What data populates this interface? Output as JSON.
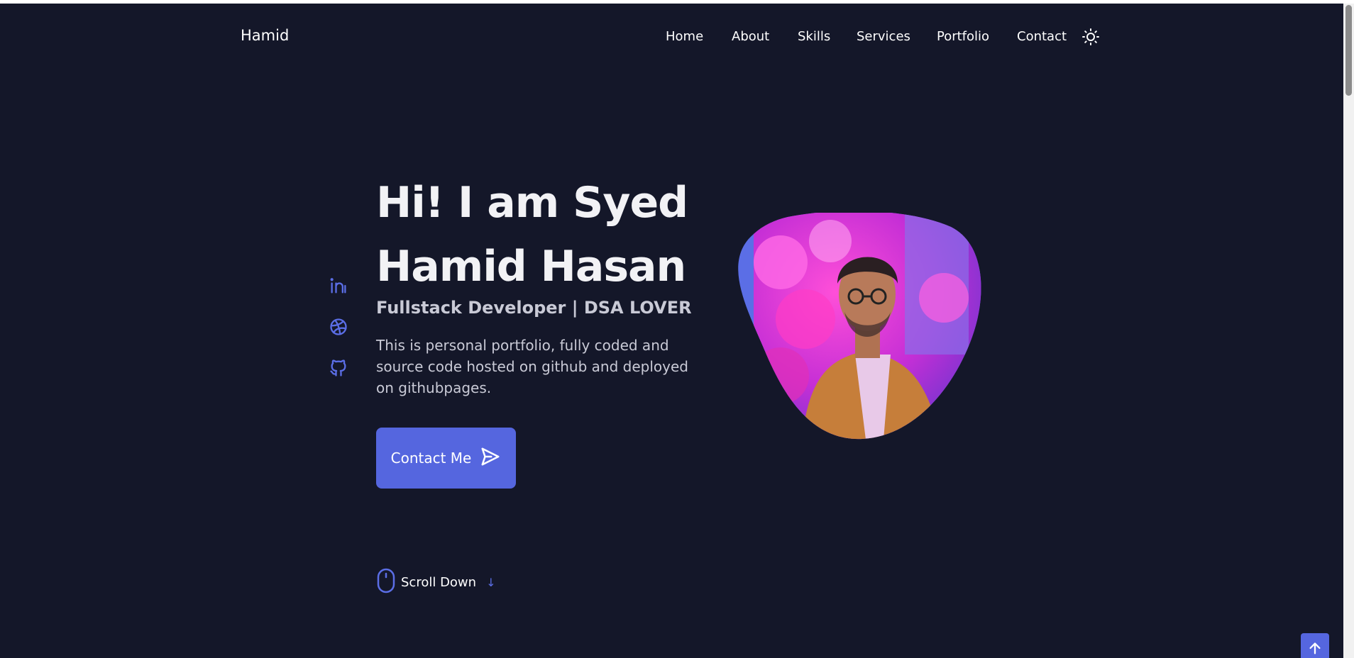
{
  "header": {
    "logo": "Hamid",
    "nav": [
      "Home",
      "About",
      "Skills",
      "Services",
      "Portfolio",
      "Contact"
    ],
    "theme_toggle_icon": "sun-icon"
  },
  "social": {
    "icons": [
      "linkedin-icon",
      "dribbble-icon",
      "github-icon"
    ]
  },
  "hero": {
    "title": "Hi! I am Syed Hamid Hasan",
    "subtitle": "Fullstack Developer | DSA LOVER",
    "description": "This is personal portfolio, fully coded and source code hosted on github and deployed on githubpages.",
    "button_label": "Contact Me",
    "button_icon": "send-icon",
    "photo_icon": "profile-photo"
  },
  "scroll_down": {
    "label": "Scroll Down",
    "icons": [
      "mouse-icon",
      "arrow-down-icon"
    ]
  },
  "scroll_up": {
    "icon": "arrow-up-icon"
  },
  "colors": {
    "background": "#141729",
    "accent": "#5566df",
    "text": "#f2f2f5",
    "muted_text": "#c9cad6"
  }
}
